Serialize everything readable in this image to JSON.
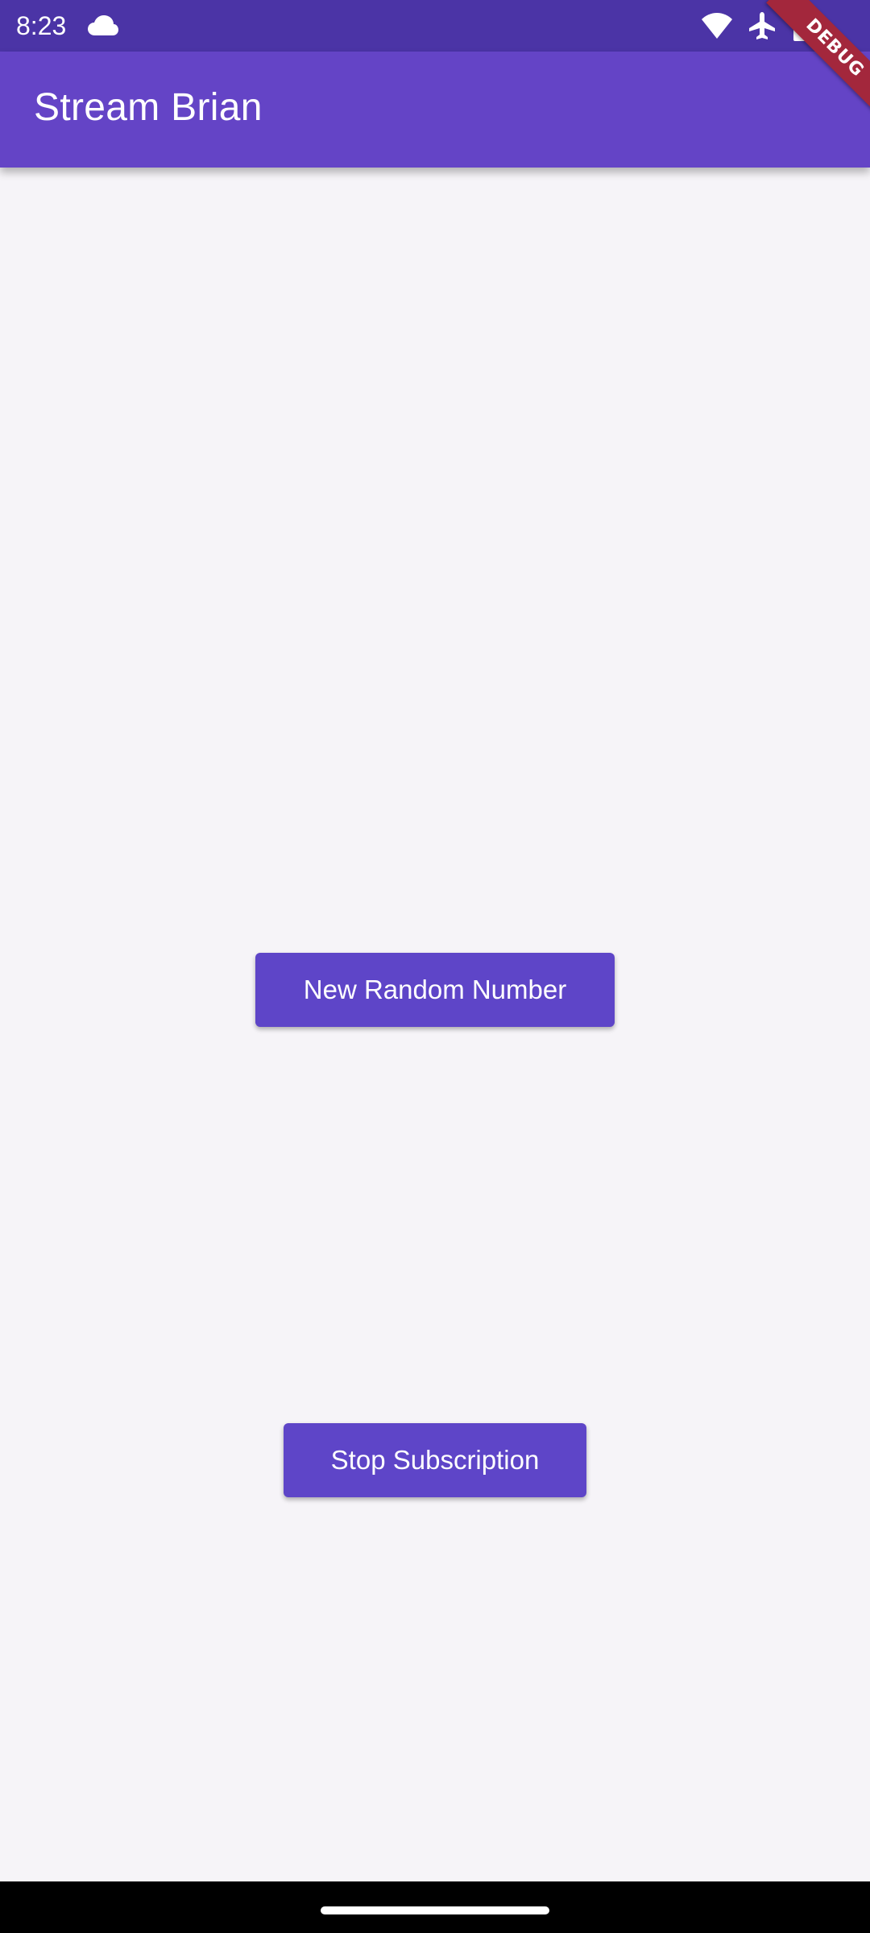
{
  "status_bar": {
    "time": "8:23",
    "icons": [
      "cloud-icon",
      "wifi-icon",
      "airplane-mode-icon",
      "battery-icon"
    ]
  },
  "app_bar": {
    "title": "Stream Brian",
    "debug_banner": "DEBUG"
  },
  "main": {
    "new_random_button": "New Random Number",
    "stop_subscription_button": "Stop Subscription"
  },
  "colors": {
    "status_bar": "#4b34a6",
    "app_bar": "#6444c6",
    "button": "#5e45c8",
    "background": "#f6f4f8",
    "debug_banner": "#a3273c"
  }
}
